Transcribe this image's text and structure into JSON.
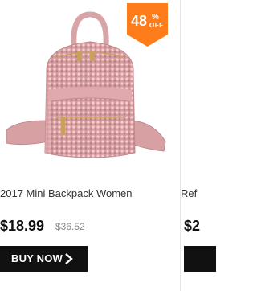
{
  "products": [
    {
      "title": "2017 Mini Backpack Women",
      "sale_price": "$18.99",
      "original_price": "$36.52",
      "discount": {
        "value": "48",
        "percent_symbol": "%",
        "label": "OFF"
      },
      "button_label": "BUY NOW",
      "image_icon": "pink-sequin-backpack-image"
    },
    {
      "title": "Ref",
      "sale_price": "$2"
    }
  ],
  "colors": {
    "badge": "#ff7c1b",
    "button": "#111111",
    "title_text": "#333333",
    "strikethrough": "#888888"
  }
}
